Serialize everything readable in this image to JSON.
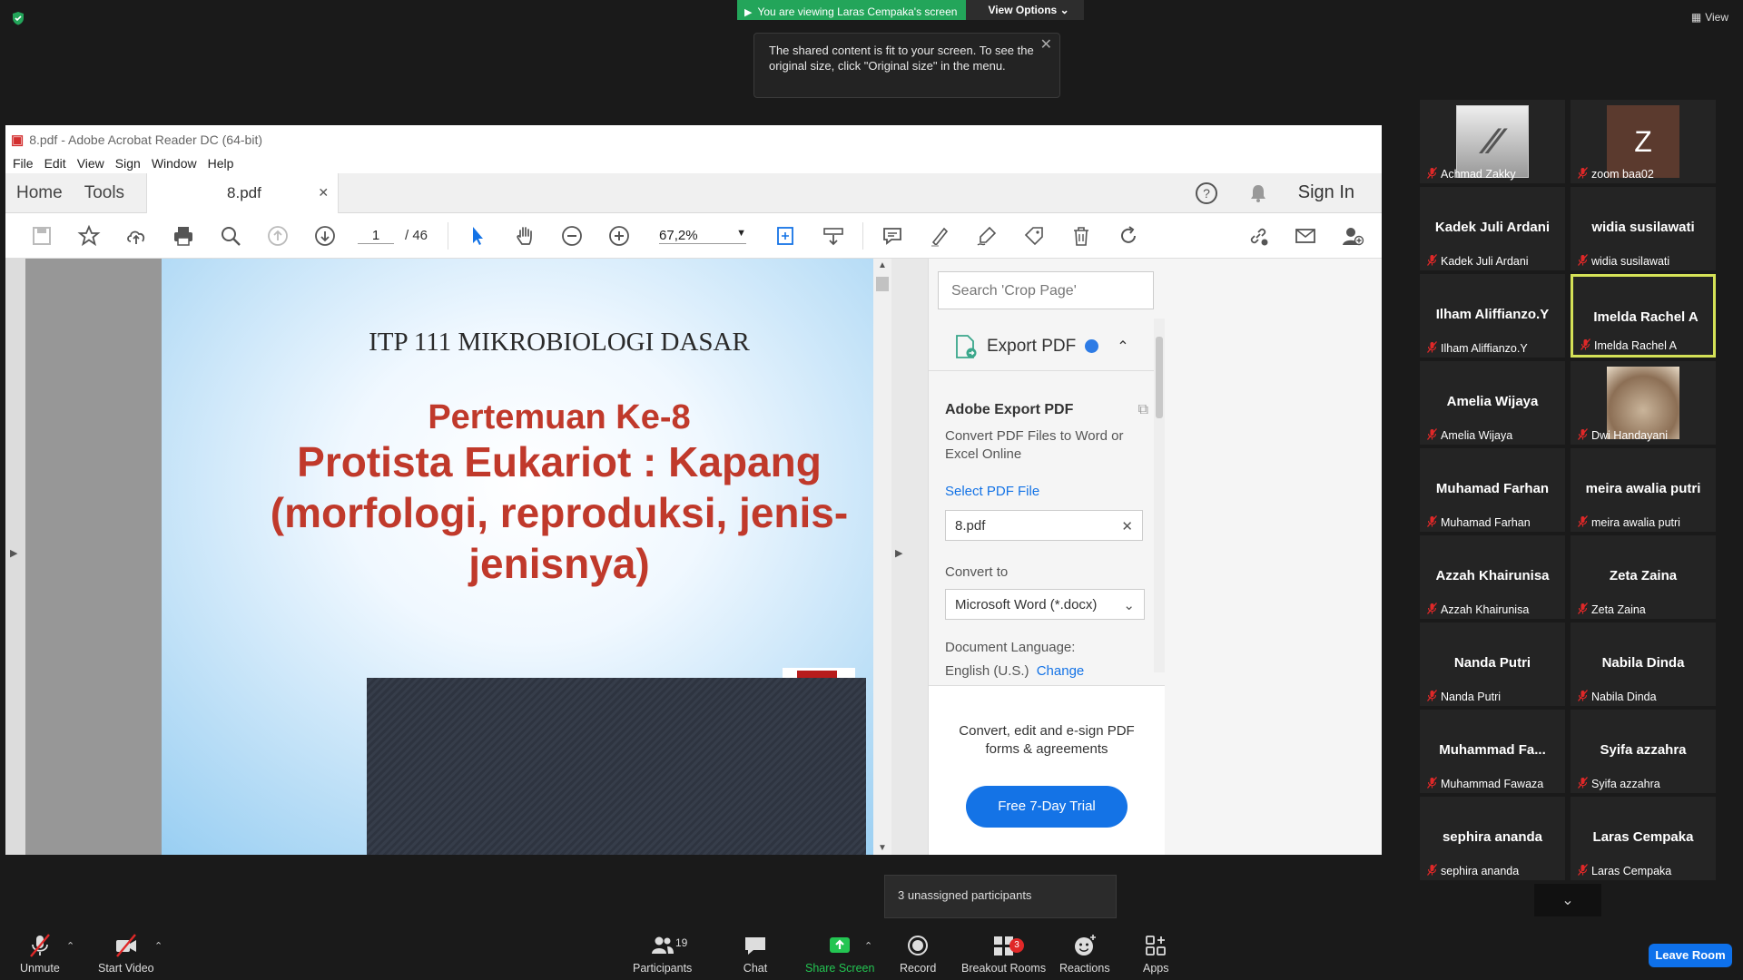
{
  "zoom": {
    "share_banner": "You are viewing Laras Cempaka's screen",
    "view_options": "View Options",
    "tooltip": "The shared content is fit to your screen. To see the original size, click \"Original size\" in the menu.",
    "view_label": "View",
    "unassigned": "3 unassigned participants",
    "participants_count": "19",
    "breakout_badge": "3",
    "buttons": {
      "unmute": "Unmute",
      "start_video": "Start Video",
      "participants": "Participants",
      "chat": "Chat",
      "share_screen": "Share Screen",
      "record": "Record",
      "breakout_rooms": "Breakout Rooms",
      "reactions": "Reactions",
      "apps": "Apps",
      "leave_room": "Leave Room"
    }
  },
  "acrobat": {
    "window_title": "8.pdf - Adobe Acrobat Reader DC (64-bit)",
    "menu": [
      "File",
      "Edit",
      "View",
      "Sign",
      "Window",
      "Help"
    ],
    "tabs": {
      "home": "Home",
      "tools": "Tools",
      "file": "8.pdf"
    },
    "sign_in": "Sign In",
    "page_current": "1",
    "page_total": "/ 46",
    "zoom_level": "67,2%",
    "slide": {
      "course": "ITP 111 MIKROBIOLOGI DASAR",
      "meeting": "Pertemuan Ke-8",
      "title": "Protista Eukariot : Kapang (morfologi, reproduksi, jenis-jenisnya)"
    },
    "right_pane": {
      "search_placeholder": "Search 'Crop Page'",
      "export_header": "Export PDF",
      "adobe_export": "Adobe Export PDF",
      "convert_desc": "Convert PDF Files to Word or Excel Online",
      "select_pdf": "Select PDF File",
      "file_name": "8.pdf",
      "convert_to": "Convert to",
      "format": "Microsoft Word (*.docx)",
      "doc_language_label": "Document Language:",
      "doc_language": "English (U.S.)",
      "change": "Change",
      "promo": "Convert, edit and e-sign PDF forms & agreements",
      "trial": "Free 7-Day Trial"
    }
  },
  "participants": [
    {
      "display": "",
      "name": "Achmad Zakky",
      "avatar": "logo"
    },
    {
      "display": "Z",
      "name": "zoom baa02",
      "avatar": "letter"
    },
    {
      "display": "Kadek Juli Ardani",
      "name": "Kadek Juli Ardani"
    },
    {
      "display": "widia susilawati",
      "name": "widia susilawati"
    },
    {
      "display": "Ilham Aliffianzo.Y",
      "name": "Ilham Aliffianzo.Y"
    },
    {
      "display": "Imelda Rachel A",
      "name": "Imelda Rachel A",
      "active": true
    },
    {
      "display": "Amelia Wijaya",
      "name": "Amelia Wijaya"
    },
    {
      "display": "",
      "name": "Dwi Handayani",
      "avatar": "photo"
    },
    {
      "display": "Muhamad Farhan",
      "name": "Muhamad Farhan"
    },
    {
      "display": "meira awalia putri",
      "name": "meira awalia putri"
    },
    {
      "display": "Azzah Khairunisa",
      "name": "Azzah Khairunisa"
    },
    {
      "display": "Zeta Zaina",
      "name": "Zeta Zaina"
    },
    {
      "display": "Nanda Putri",
      "name": "Nanda Putri"
    },
    {
      "display": "Nabila Dinda",
      "name": "Nabila Dinda"
    },
    {
      "display": "Muhammad Fa...",
      "name": "Muhammad Fawaza"
    },
    {
      "display": "Syifa azzahra",
      "name": "Syifa azzahra"
    },
    {
      "display": "sephira ananda",
      "name": "sephira ananda"
    },
    {
      "display": "Laras Cempaka",
      "name": "Laras Cempaka"
    }
  ]
}
